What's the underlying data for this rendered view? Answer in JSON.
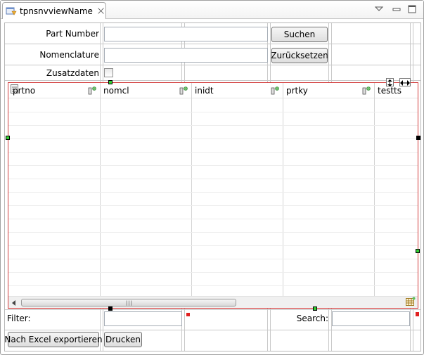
{
  "tab": {
    "title": "tpnsnvviewName",
    "icon": "view-icon"
  },
  "window_controls": [
    "view-menu-icon",
    "minimize-icon",
    "maximize-icon"
  ],
  "form": {
    "part_number_label": "Part Number",
    "part_number_value": "",
    "nomenclature_label": "Nomenclature",
    "nomenclature_value": "",
    "zusatzdaten_label": "Zusatzdaten",
    "zusatzdaten_checked": false,
    "search_button": "Suchen",
    "reset_button": "Zurücksetzen"
  },
  "table": {
    "columns": [
      {
        "key": "prtno",
        "label": "prtno"
      },
      {
        "key": "nomcl",
        "label": "nomcl"
      },
      {
        "key": "inidt",
        "label": "inidt"
      },
      {
        "key": "prtky",
        "label": "prtky"
      },
      {
        "key": "testts",
        "label": "testts"
      }
    ],
    "rows": []
  },
  "filter": {
    "label": "Filter:",
    "value": ""
  },
  "search": {
    "label": "Search:",
    "value": ""
  },
  "actions": {
    "export_button": "Nach Excel exportieren",
    "print_button": "Drucken"
  },
  "colors": {
    "selection_border": "#d23a3a",
    "handle_green": "#33cc33",
    "handle_red": "#e02020"
  }
}
